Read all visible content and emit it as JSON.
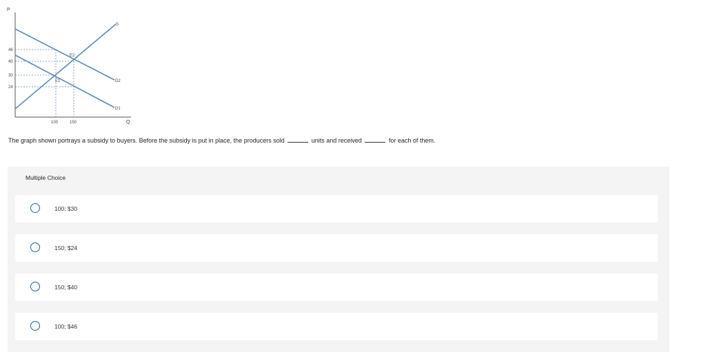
{
  "graph": {
    "p_axis_label": "P",
    "q_axis_label": "Q",
    "y_ticks": [
      "46",
      "40",
      "30",
      "24"
    ],
    "x_ticks": [
      "100",
      "150"
    ],
    "labels": {
      "supply": "S",
      "demand_2": "D2",
      "demand_1": "D1",
      "equilibrium_2": "E2",
      "equilibrium_1": "E1"
    },
    "line_color": "#5b8bb8"
  },
  "question": {
    "part1": "The graph shown portrays a subsidy to buyers. Before the subsidy is put in place, the producers sold",
    "part2": "units and received",
    "part3": "for each of them."
  },
  "multiple_choice": {
    "header": "Multiple Choice",
    "options": [
      {
        "label": "100; $30"
      },
      {
        "label": "150; $24"
      },
      {
        "label": "150; $40"
      },
      {
        "label": "100; $46"
      }
    ]
  }
}
